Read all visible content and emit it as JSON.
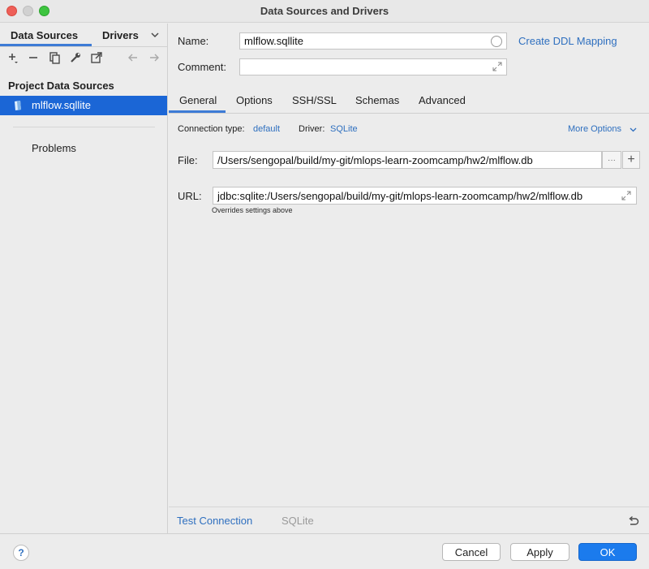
{
  "window": {
    "title": "Data Sources and Drivers"
  },
  "sidebar": {
    "tabs": [
      {
        "label": "Data Sources"
      },
      {
        "label": "Drivers"
      }
    ],
    "toolbar": {
      "add_icon": "+",
      "remove_icon": "−"
    },
    "section_title": "Project Data Sources",
    "items": [
      {
        "label": "mlflow.sqllite",
        "selected": true
      }
    ],
    "problems_label": "Problems"
  },
  "form": {
    "name_label": "Name:",
    "name_value": "mlflow.sqllite",
    "comment_label": "Comment:",
    "comment_value": "",
    "ddl_link": "Create DDL Mapping"
  },
  "tabs": [
    {
      "label": "General",
      "active": true
    },
    {
      "label": "Options"
    },
    {
      "label": "SSH/SSL"
    },
    {
      "label": "Schemas"
    },
    {
      "label": "Advanced"
    }
  ],
  "general": {
    "connection_type_label": "Connection type:",
    "connection_type_value": "default",
    "driver_label": "Driver:",
    "driver_value": "SQLite",
    "more_options": "More Options",
    "file_label": "File:",
    "file_value": "/Users/sengopal/build/my-git/mlops-learn-zoomcamp/hw2/mlflow.db",
    "browse_label": "···",
    "plus_label": "+",
    "url_label": "URL:",
    "url_value": "jdbc:sqlite:/Users/sengopal/build/my-git/mlops-learn-zoomcamp/hw2/mlflow.db",
    "overrides_note": "Overrides settings above"
  },
  "bottom_bar": {
    "test_connection": "Test Connection",
    "driver_name": "SQLite"
  },
  "footer": {
    "help": "?",
    "cancel": "Cancel",
    "apply": "Apply",
    "ok": "OK"
  },
  "colors": {
    "accent": "#1b66d6",
    "link": "#2e6fbf",
    "ok_button": "#1b7bed"
  }
}
